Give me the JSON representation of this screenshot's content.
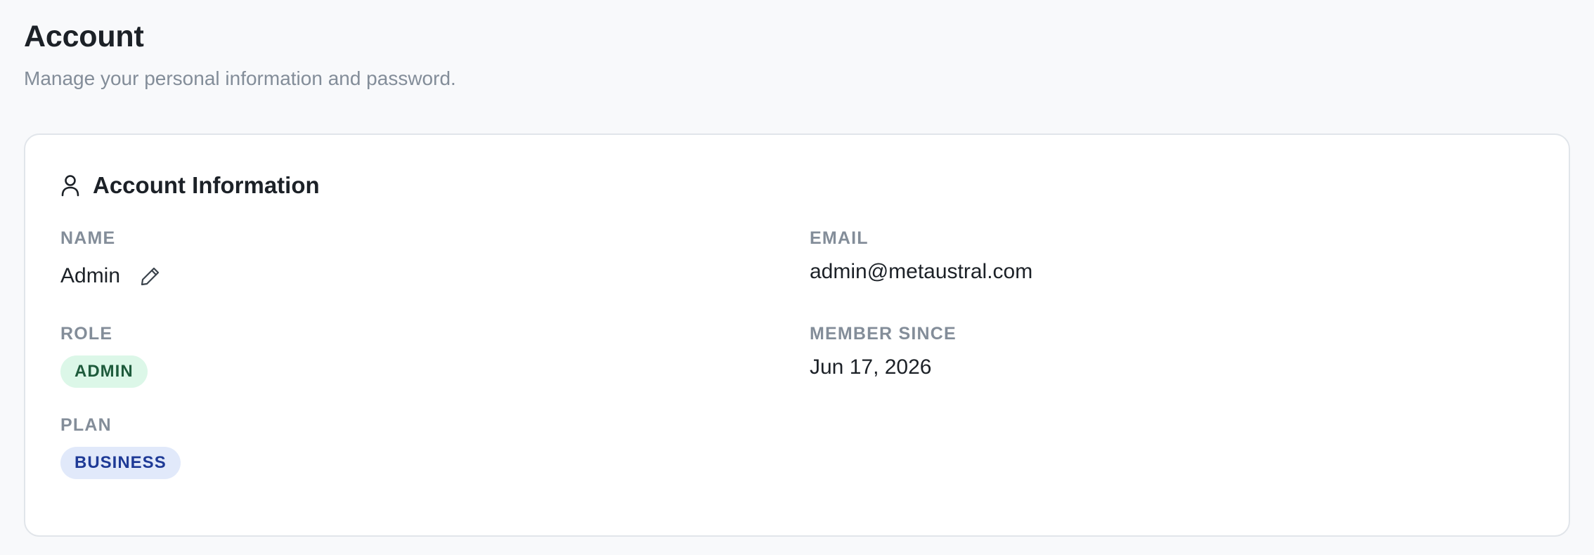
{
  "header": {
    "title": "Account",
    "subtitle": "Manage your personal information and password."
  },
  "account_card": {
    "title": "Account Information",
    "icon": "user-icon",
    "name": {
      "label": "NAME",
      "value": "Admin",
      "edit_icon": "pencil-icon"
    },
    "email": {
      "label": "EMAIL",
      "value": "admin@metaustral.com"
    },
    "role": {
      "label": "ROLE",
      "badge": "ADMIN",
      "badge_bg": "#dcf7e8",
      "badge_fg": "#1e5b3c"
    },
    "member_since": {
      "label": "MEMBER SINCE",
      "value": "Jun 17, 2026"
    },
    "plan": {
      "label": "PLAN",
      "badge": "BUSINESS",
      "badge_bg": "#e1e9fa",
      "badge_fg": "#1e3a96"
    }
  }
}
